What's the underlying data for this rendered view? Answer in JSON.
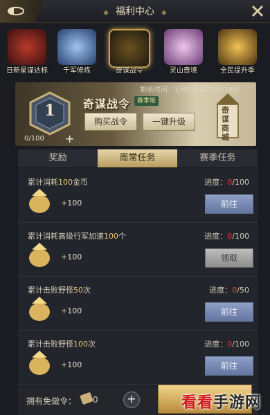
{
  "header": {
    "title": "福利中心"
  },
  "events": [
    {
      "label": "日新星谋达标",
      "icon": "red-warrior-icon",
      "color": "#7a1c1c"
    },
    {
      "label": "千军修炼",
      "icon": "blue-crystal-icon",
      "color": "#3a5f9c"
    },
    {
      "label": "奇谋战令",
      "icon": "golden-dragon-icon",
      "color": "#c9a24d"
    },
    {
      "label": "灵山奇境",
      "icon": "lotus-icon",
      "color": "#b77bb6"
    },
    {
      "label": "全民提升季",
      "icon": "golden-sword-icon",
      "color": "#c08b23"
    }
  ],
  "banner": {
    "timer": "剩余时间：1月5日6时26分16秒",
    "level": "1",
    "progress": "0/100",
    "pass_title": "奇谋战令",
    "pass_tag": "春季版",
    "buy_label": "购买战令",
    "upgrade_label": "一键升级",
    "store_label": "奇谋商城"
  },
  "tabs": [
    {
      "label": "奖励",
      "active": false
    },
    {
      "label": "周常任务",
      "active": true
    },
    {
      "label": "赛季任务",
      "active": false
    }
  ],
  "tasks": [
    {
      "name_pre": "累计消耗",
      "name_hl": "100",
      "name_post": "金币",
      "prog_label": "进度：",
      "cur": "0",
      "total": "/100",
      "reward": "+100",
      "button": "前往",
      "type": "go"
    },
    {
      "name_pre": "累计消耗高级行军加速",
      "name_hl": "100",
      "name_post": "个",
      "prog_label": "进度：",
      "cur": "0",
      "total": "/100",
      "reward": "+100",
      "button": "领取",
      "type": "claim"
    },
    {
      "name_pre": "累计击败野怪",
      "name_hl": "50",
      "name_post": "次",
      "prog_label": "进度：",
      "cur": "0",
      "total": "/50",
      "reward": "+100",
      "button": "前往",
      "type": "go"
    },
    {
      "name_pre": "累计击败野怪",
      "name_hl": "100",
      "name_post": "次",
      "prog_label": "进度：",
      "cur": "0",
      "total": "/100",
      "reward": "+100",
      "button": "前往",
      "type": "go"
    }
  ],
  "footer": {
    "free_label": "拥有免做令：",
    "free_count": "0"
  },
  "watermark": {
    "logo": "看看",
    "text": "手游网"
  }
}
